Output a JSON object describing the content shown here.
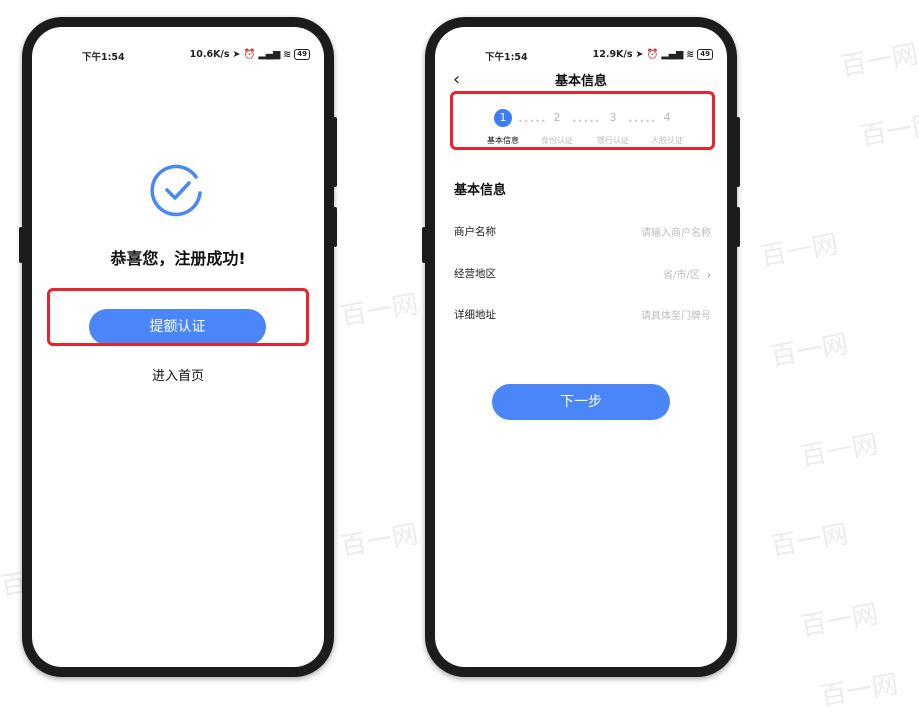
{
  "watermark": {
    "text": "百一网"
  },
  "phone1": {
    "status": {
      "time": "下午1:54",
      "speed": "10.6K/s",
      "battery": "49"
    },
    "success_title": "恭喜您，注册成功!",
    "primary_button": "提额认证",
    "home_link": "进入首页",
    "colors": {
      "accent": "#4a86f7",
      "highlight": "#e8232a"
    }
  },
  "phone2": {
    "status": {
      "time": "下午1:54",
      "speed": "12.9K/s",
      "battery": "49"
    },
    "nav_title": "基本信息",
    "steps": [
      {
        "num": "1",
        "label": "基本信息"
      },
      {
        "num": "2",
        "label": "身份认证"
      },
      {
        "num": "3",
        "label": "银行认证"
      },
      {
        "num": "4",
        "label": "人脸认证"
      }
    ],
    "section_title": "基本信息",
    "fields": [
      {
        "label": "商户名称",
        "placeholder": "请输入商户名称"
      },
      {
        "label": "经营地区",
        "placeholder": "省/市/区"
      },
      {
        "label": "详细地址",
        "placeholder": "请具体至门牌号"
      }
    ],
    "next_button": "下一步"
  }
}
